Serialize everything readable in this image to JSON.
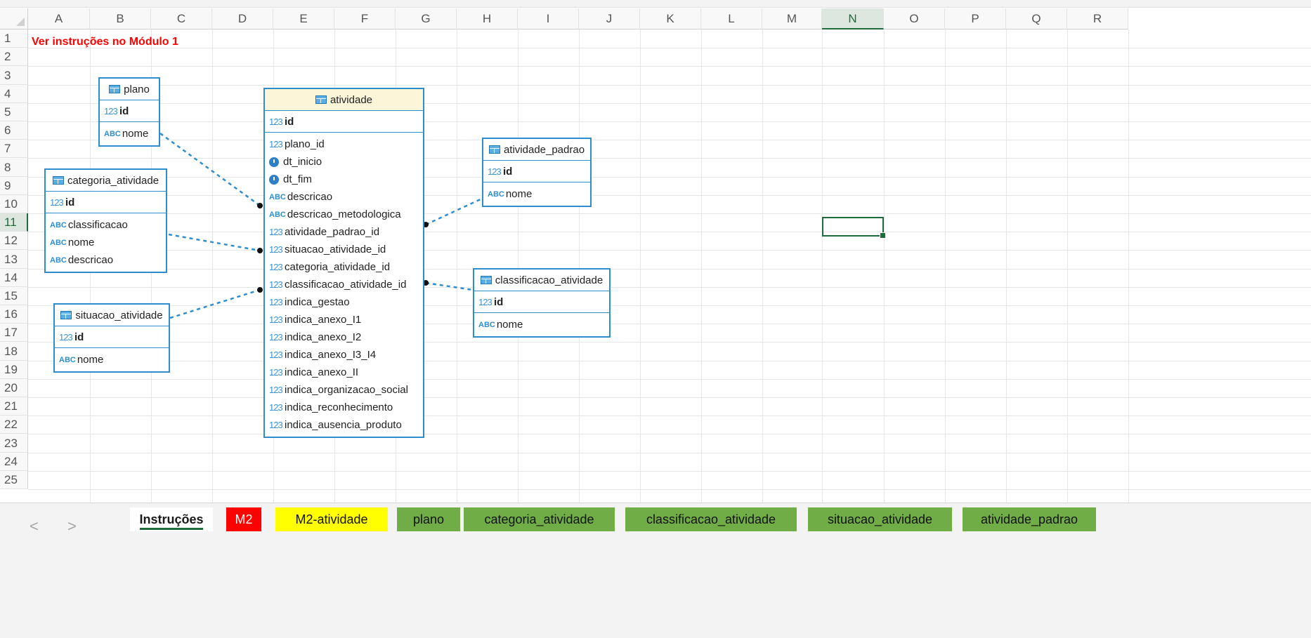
{
  "sheet": {
    "columns": [
      "A",
      "B",
      "C",
      "D",
      "E",
      "F",
      "G",
      "H",
      "I",
      "J",
      "K",
      "L",
      "M",
      "N",
      "O",
      "P",
      "Q",
      "R"
    ],
    "rows": [
      "1",
      "2",
      "3",
      "4",
      "5",
      "6",
      "7",
      "8",
      "9",
      "10",
      "11",
      "12",
      "13",
      "14",
      "15",
      "16",
      "17",
      "18",
      "19",
      "20",
      "21",
      "22",
      "23",
      "24",
      "25"
    ],
    "cell_A1": "Ver instruções no Módulo 1",
    "active_cell": "N11",
    "accent_color": "#1e6b3c"
  },
  "entities": {
    "plano": {
      "name": "plano",
      "pk": "id",
      "fields": [
        {
          "icon": "ABC",
          "name": "nome"
        }
      ]
    },
    "categoria_atividade": {
      "name": "categoria_atividade",
      "pk": "id",
      "fields": [
        {
          "icon": "ABC",
          "name": "classificacao"
        },
        {
          "icon": "ABC",
          "name": "nome"
        },
        {
          "icon": "ABC",
          "name": "descricao"
        }
      ]
    },
    "situacao_atividade": {
      "name": "situacao_atividade",
      "pk": "id",
      "fields": [
        {
          "icon": "ABC",
          "name": "nome"
        }
      ]
    },
    "atividade": {
      "name": "atividade",
      "pk": "id",
      "fields": [
        {
          "icon": "123",
          "name": "plano_id"
        },
        {
          "icon": "clock",
          "name": "dt_inicio"
        },
        {
          "icon": "clock",
          "name": "dt_fim"
        },
        {
          "icon": "ABC",
          "name": "descricao"
        },
        {
          "icon": "ABC",
          "name": "descricao_metodologica"
        },
        {
          "icon": "123",
          "name": "atividade_padrao_id"
        },
        {
          "icon": "123",
          "name": "situacao_atividade_id"
        },
        {
          "icon": "123",
          "name": "categoria_atividade_id"
        },
        {
          "icon": "123",
          "name": "classificacao_atividade_id"
        },
        {
          "icon": "123",
          "name": "indica_gestao"
        },
        {
          "icon": "123",
          "name": "indica_anexo_I1"
        },
        {
          "icon": "123",
          "name": "indica_anexo_I2"
        },
        {
          "icon": "123",
          "name": "indica_anexo_I3_I4"
        },
        {
          "icon": "123",
          "name": "indica_anexo_II"
        },
        {
          "icon": "123",
          "name": "indica_organizacao_social"
        },
        {
          "icon": "123",
          "name": "indica_reconhecimento"
        },
        {
          "icon": "123",
          "name": "indica_ausencia_produto"
        }
      ]
    },
    "atividade_padrao": {
      "name": "atividade_padrao",
      "pk": "id",
      "fields": [
        {
          "icon": "ABC",
          "name": "nome"
        }
      ]
    },
    "classificacao_atividade": {
      "name": "classificacao_atividade",
      "pk": "id",
      "fields": [
        {
          "icon": "ABC",
          "name": "nome"
        }
      ]
    }
  },
  "tabs": {
    "prev": "<",
    "next": ">",
    "items": [
      {
        "label": "Instruções",
        "color": "#ffffff",
        "active": true
      },
      {
        "label": "M2",
        "color": "#ff0000"
      },
      {
        "label": "M2-atividade",
        "color": "#ffff00"
      },
      {
        "label": "plano",
        "color": "#70ad47"
      },
      {
        "label": "categoria_atividade",
        "color": "#70ad47"
      },
      {
        "label": "classificacao_atividade",
        "color": "#70ad47"
      },
      {
        "label": "situacao_atividade",
        "color": "#70ad47"
      },
      {
        "label": "atividade_padrao",
        "color": "#70ad47"
      }
    ]
  }
}
